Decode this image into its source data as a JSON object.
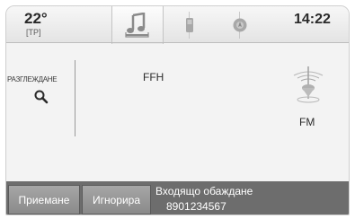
{
  "header": {
    "temperature": "22°",
    "climate_mode": "[TP]",
    "clock": "14:22",
    "tabs": [
      {
        "icon": "music-note-icon",
        "active": true
      },
      {
        "icon": "phone-icon",
        "active": false
      },
      {
        "icon": "navigation-icon",
        "active": false
      }
    ]
  },
  "main": {
    "browse_label": "РАЗГЛЕЖДАНЕ",
    "browse_icon": "search-icon",
    "station_name": "FFH",
    "band": "FM",
    "band_icon": "antenna-icon"
  },
  "callbar": {
    "accept_label": "Приемане",
    "ignore_label": "Игнорира",
    "title": "Входящо обаждане",
    "number": "8901234567"
  },
  "colors": {
    "callbar_bg": "#6d6d6d",
    "button_bg": "#9a9a9a",
    "screen_bg": "#f3f3f3"
  }
}
